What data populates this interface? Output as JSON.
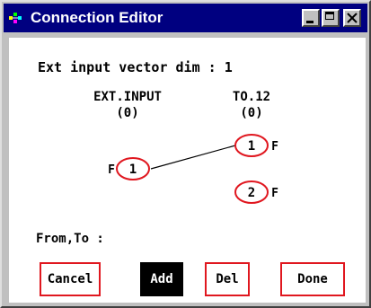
{
  "window": {
    "title": "Connection Editor"
  },
  "info": {
    "ext_input_dim": "Ext input vector dim : 1"
  },
  "columns": {
    "source": {
      "title": "EXT.INPUT",
      "count": "(0)"
    },
    "target": {
      "title": "TO.12",
      "count": "(0)"
    }
  },
  "nodes": {
    "source": [
      {
        "number": "1",
        "side_label": "F"
      }
    ],
    "target": [
      {
        "number": "1",
        "side_label": "F"
      },
      {
        "number": "2",
        "side_label": "F"
      }
    ]
  },
  "connections": [
    {
      "from": "1",
      "to": "1"
    }
  ],
  "from_to_label": "From,To :",
  "buttons": {
    "cancel": "Cancel",
    "add": "Add",
    "del": "Del",
    "done": "Done"
  },
  "colors": {
    "title_bar": "#000080",
    "node_outline": "#e0171f",
    "button_border": "#e0171f",
    "add_bg": "#000000"
  }
}
